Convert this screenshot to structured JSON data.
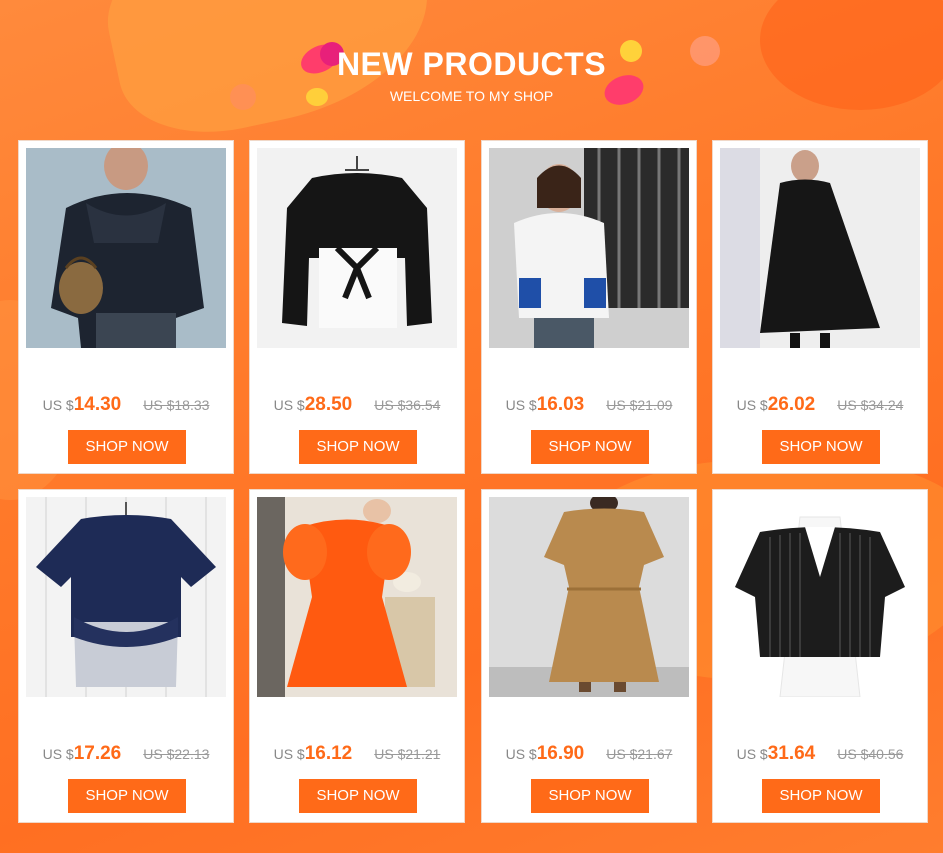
{
  "header": {
    "title": "NEW PRODUCTS",
    "subtitle": "WELCOME TO MY SHOP"
  },
  "colors": {
    "accent": "#ff6a18",
    "background": "#ff7a2a",
    "card": "#ffffff"
  },
  "products": [
    {
      "currency": "US $",
      "price": "14.30",
      "old_price": "US $18.33",
      "button": "SHOP NOW",
      "image": "ruffled-navy-blouse-with-bag"
    },
    {
      "currency": "US $",
      "price": "28.50",
      "old_price": "US $36.54",
      "button": "SHOP NOW",
      "image": "black-sweatshirt-white-shirt-tie"
    },
    {
      "currency": "US $",
      "price": "16.03",
      "old_price": "US $21.09",
      "button": "SHOP NOW",
      "image": "white-blazer-blue-corset"
    },
    {
      "currency": "US $",
      "price": "26.02",
      "old_price": "US $34.24",
      "button": "SHOP NOW",
      "image": "black-pleated-dress"
    },
    {
      "currency": "US $",
      "price": "17.26",
      "old_price": "US $22.13",
      "button": "SHOP NOW",
      "image": "navy-tee-striped-hem"
    },
    {
      "currency": "US $",
      "price": "16.12",
      "old_price": "US $21.21",
      "button": "SHOP NOW",
      "image": "orange-puff-sleeve-dress"
    },
    {
      "currency": "US $",
      "price": "16.90",
      "old_price": "US $21.67",
      "button": "SHOP NOW",
      "image": "khaki-linen-maxi-dress"
    },
    {
      "currency": "US $",
      "price": "31.64",
      "old_price": "US $40.56",
      "button": "SHOP NOW",
      "image": "pinstripe-vest-white-shirt"
    }
  ]
}
